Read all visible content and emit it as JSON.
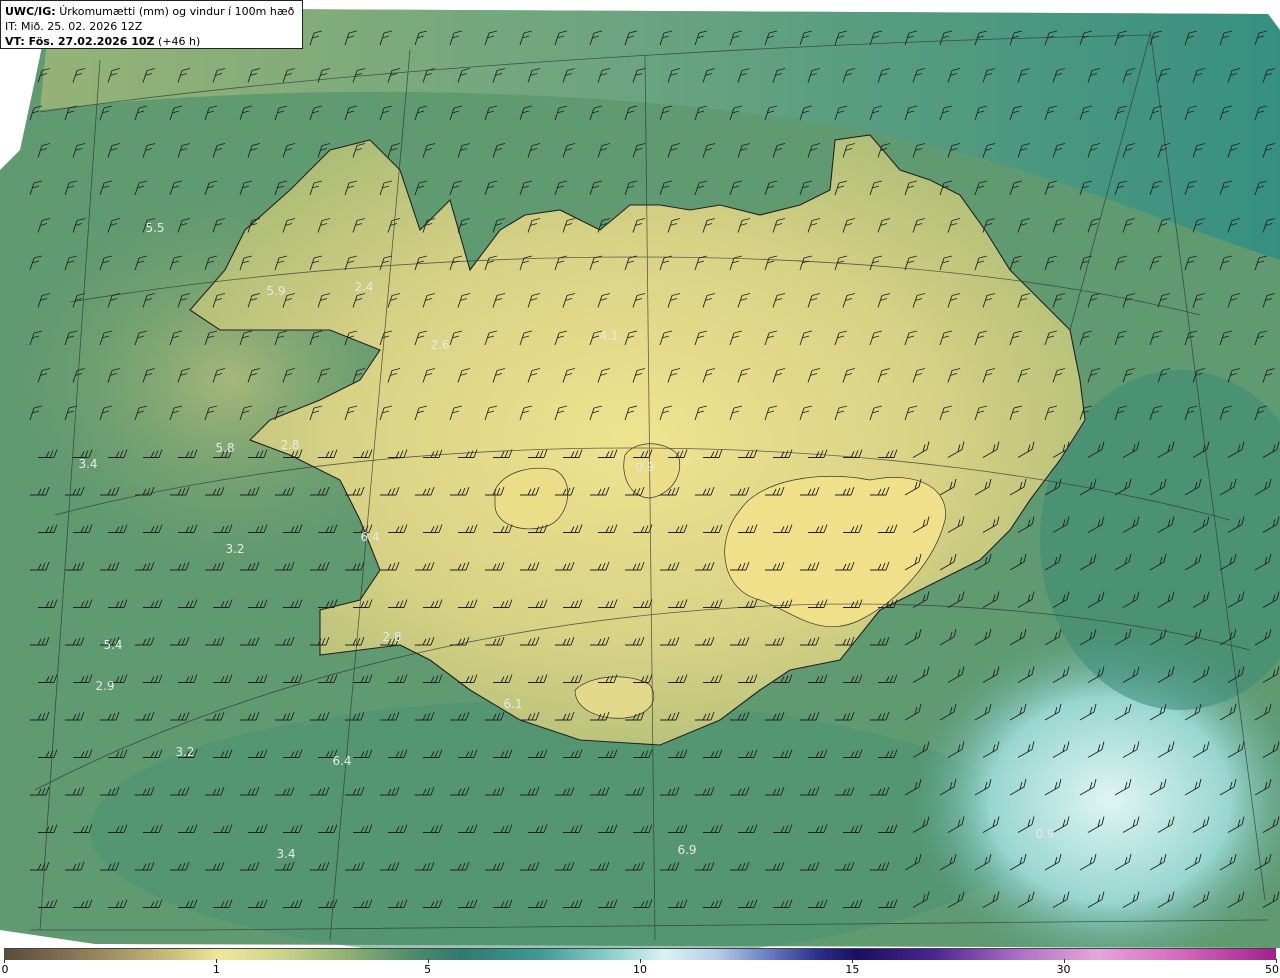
{
  "header": {
    "title_bold": "UWC/IG:",
    "title_rest": "Úrkomumætti (mm) og vindur í 100m hæð",
    "issue_time": "IT: Mið. 25. 02. 2026 12Z",
    "valid_label": "VT: Fös. 27.02.2026 10Z",
    "valid_offset": "(+46 h)"
  },
  "colorbar": {
    "ticks": [
      "0",
      "1",
      "5",
      "10",
      "15",
      "30",
      "50"
    ],
    "fractions": [
      0.0,
      0.167,
      0.333,
      0.5,
      0.667,
      0.833,
      1.0
    ]
  },
  "value_labels": [
    {
      "text": "5.5"
    },
    {
      "text": "5.9"
    },
    {
      "text": "2.4"
    },
    {
      "text": "2.6"
    },
    {
      "text": "4.1"
    },
    {
      "text": "3.4"
    },
    {
      "text": "5.8"
    },
    {
      "text": "2.8"
    },
    {
      "text": "6.4"
    },
    {
      "text": "3.2"
    },
    {
      "text": "5.4"
    },
    {
      "text": "2.9"
    },
    {
      "text": "2.8"
    },
    {
      "text": "6.1"
    },
    {
      "text": "3.2"
    },
    {
      "text": "6.4"
    },
    {
      "text": "3.4"
    },
    {
      "text": "6.9"
    },
    {
      "text": "0.9"
    },
    {
      "text": "0.9"
    }
  ],
  "colors": {
    "land_yellow": "#e8dc8c",
    "sea_green": "#3f8a6e",
    "deep_teal": "#2c7a6e",
    "light_cyan": "#c4ece6"
  }
}
